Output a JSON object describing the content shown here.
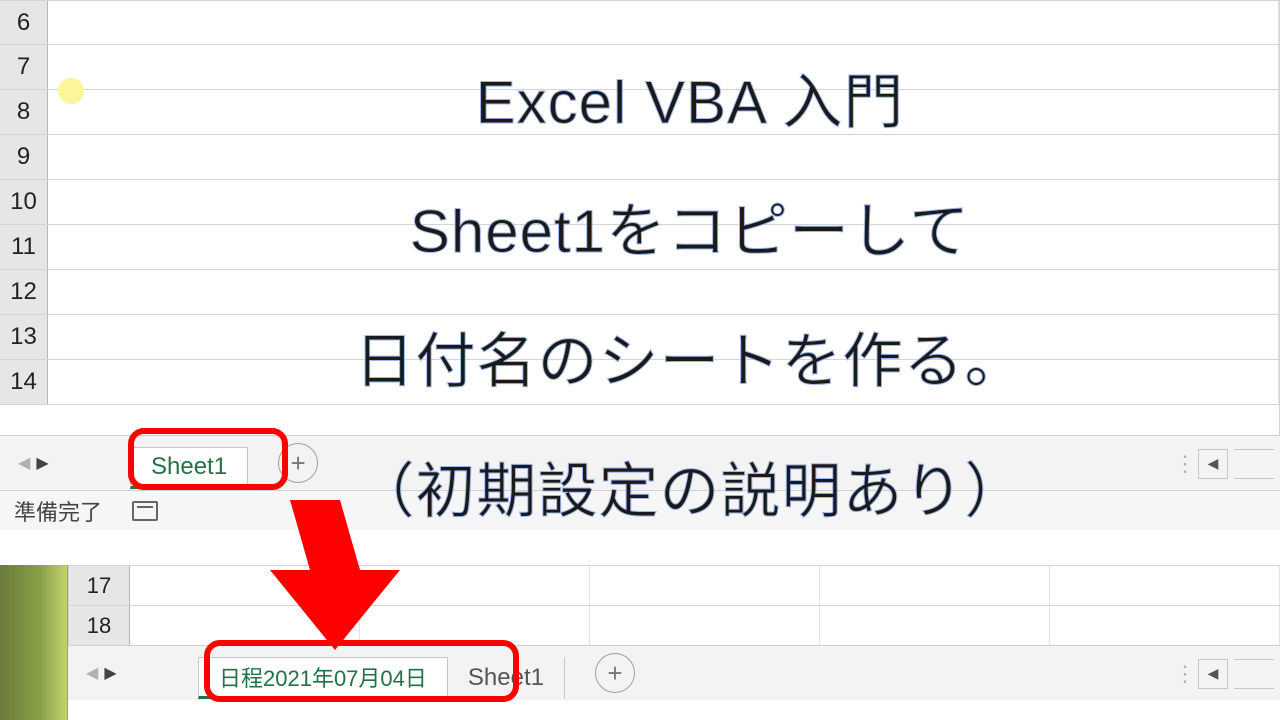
{
  "overlay": {
    "line1": "Excel VBA 入門",
    "line2": "Sheet1をコピーして",
    "line3": "日付名のシートを作る。",
    "line4": "（初期設定の説明あり）"
  },
  "top_panel": {
    "row_headers": [
      "6",
      "7",
      "8",
      "9",
      "10",
      "11",
      "12",
      "13",
      "14"
    ],
    "tabs": {
      "active": "Sheet1",
      "add_icon": "+"
    },
    "status": "準備完了"
  },
  "bottom_panel": {
    "row_headers": [
      "17",
      "18"
    ],
    "tabs": {
      "active": "日程2021年07月04日",
      "second": "Sheet1",
      "add_icon": "+"
    }
  },
  "nav": {
    "left_tri": "◀",
    "right_tri": "▶",
    "vdots": "⋮"
  }
}
